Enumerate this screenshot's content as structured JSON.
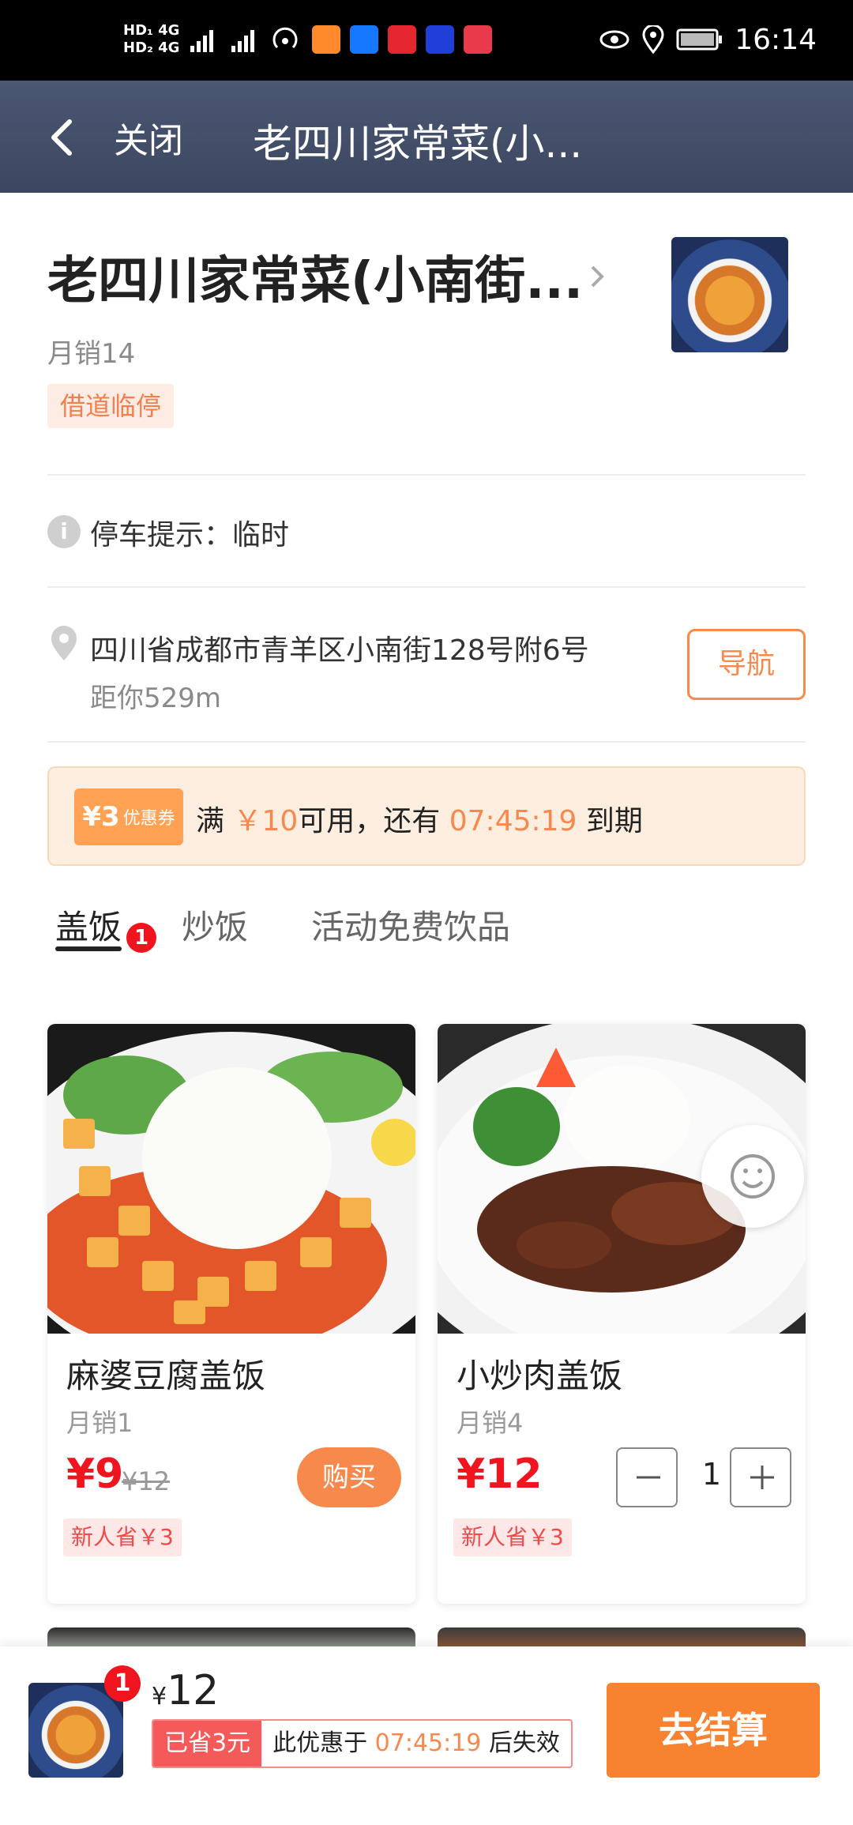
{
  "status_bar": {
    "net1": "HD₁ 4G",
    "net2": "HD₂ 4G",
    "time": "16:14"
  },
  "header": {
    "close_label": "关闭",
    "title": "老四川家常菜(小..."
  },
  "store": {
    "name": "老四川家常菜(小南街...",
    "monthly_sales": "月销14",
    "parking_tag": "借道临停",
    "parking_tip": "停车提示：临时",
    "address": "四川省成都市青羊区小南街128号附6号",
    "distance": "距你529m",
    "nav_label": "导航"
  },
  "coupon": {
    "badge_amount": "¥3",
    "badge_label": "优惠券",
    "text_prefix": "满",
    "threshold": "￥10",
    "text_mid": "可用，还有",
    "countdown": "07:45:19",
    "text_suffix": "到期"
  },
  "tabs": [
    {
      "label": "盖饭",
      "badge": "1"
    },
    {
      "label": "炒饭"
    },
    {
      "label": "活动免费饮品"
    }
  ],
  "products": [
    {
      "name": "麻婆豆腐盖饭",
      "sales": "月销1",
      "price": "¥9",
      "original_price": "¥12",
      "action_label": "购买",
      "newbie_tag": "新人省￥3"
    },
    {
      "name": "小炒肉盖饭",
      "sales": "月销4",
      "price": "¥12",
      "quantity": "1",
      "newbie_tag": "新人省￥3"
    }
  ],
  "cart": {
    "badge": "1",
    "currency": "¥",
    "total": "12",
    "saved_label": "已省3元",
    "promo_prefix": "此优惠于",
    "promo_countdown": "07:45:19",
    "promo_suffix": "后失效",
    "checkout_label": "去结算"
  },
  "colors": {
    "accent_orange": "#f7894d",
    "price_red": "#f0141e",
    "header_bg": "#45516b"
  }
}
